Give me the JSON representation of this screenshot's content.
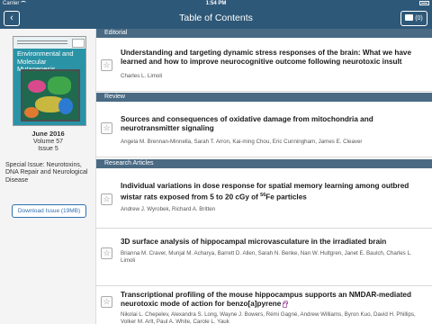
{
  "status_bar": {
    "carrier": "Carrier",
    "time": "1:54 PM"
  },
  "nav": {
    "title": "Table of Contents",
    "download_count": "(0)"
  },
  "sidebar": {
    "cover_title": "Environmental and Molecular Mutagenesis",
    "date": "June 2016",
    "volume": "Volume 57",
    "issue": "Issue 5",
    "special_issue": "Special Issue: Neurotoxins, DNA Repair and Neurological Disease",
    "download_button": "Download Issue (19MB)"
  },
  "sections": [
    {
      "name": "Editorial"
    },
    {
      "name": "Review"
    },
    {
      "name": "Research Articles"
    }
  ],
  "articles": [
    {
      "title": "Understanding and targeting dynamic stress responses of the brain: What we have learned and how to improve neurocognitive outcome following neurotoxic insult",
      "authors": "Charles L. Limoli"
    },
    {
      "title": "Sources and consequences of oxidative damage from mitochondria and neurotransmitter signaling",
      "authors": "Angela M. Brennan-Minnella, Sarah T. Arron, Kai-ming Chou, Eric Cunningham, James E. Cleaver"
    },
    {
      "title_pre": "Individual variations in dose response for spatial memory learning among outbred wistar rats exposed from 5 to 20 cGy of ",
      "title_sup": "56",
      "title_post": "Fe particles",
      "authors": "Andrew J. Wyrobek, Richard A. Britten"
    },
    {
      "title": "3D surface analysis of hippocampal microvasculature in the irradiated brain",
      "authors": "Brianna M. Craver, Munjal M. Acharya, Barrett D. Allen, Sarah N. Benke, Nan W. Hultgren, Janet E. Baulch, Charles L. Limoli"
    },
    {
      "title": "Transcriptional profiling of the mouse hippocampus supports an NMDAR-mediated neurotoxic mode of action for benzo[a]pyrene",
      "authors": "Nikolai L. Chepelev, Alexandra S. Long, Wayne J. Bowers, Rémi Gagné, Andrew Williams, Byron Kuo, David H. Phillips, Volker M. Arlt, Paul A. White, Carole L. Yauk"
    }
  ]
}
